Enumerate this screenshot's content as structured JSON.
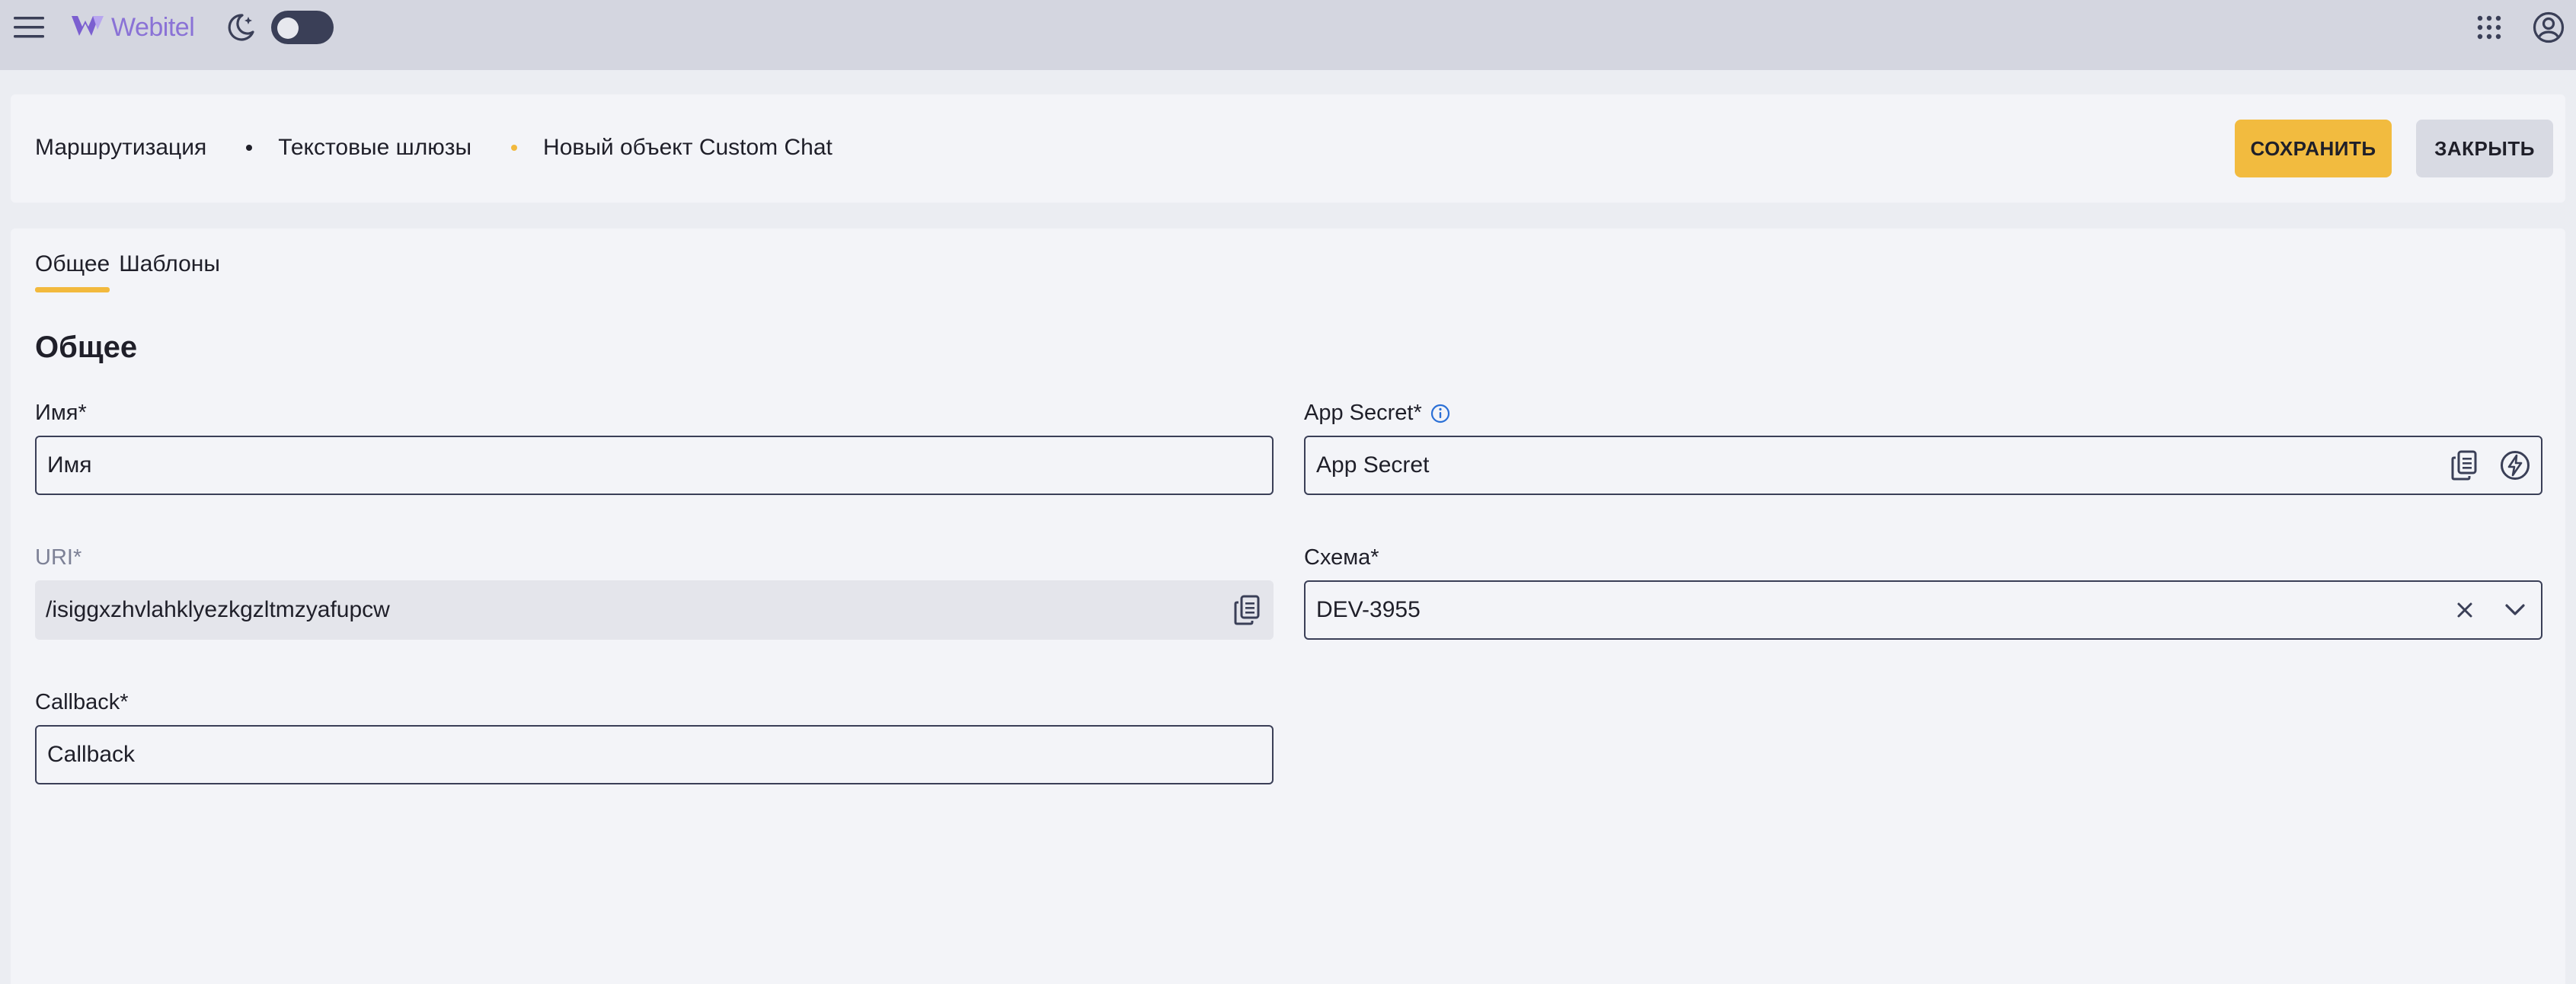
{
  "topbar": {
    "logo_text": "Webitel",
    "icons": [
      "menu-icon",
      "webitel-logo-icon",
      "moon-icon",
      "apps-grid-icon",
      "account-icon"
    ],
    "theme_toggle": "off"
  },
  "header": {
    "breadcrumb": [
      "Маршрутизация",
      "Текстовые шлюзы",
      "Новый объект Custom Chat"
    ],
    "save_label": "СОХРАНИТЬ",
    "close_label": "ЗАКРЫТЬ"
  },
  "tabs": [
    {
      "label": "Общее",
      "active": true
    },
    {
      "label": "Шаблоны",
      "active": false
    }
  ],
  "section_title": "Общее",
  "form": {
    "name": {
      "label": "Имя*",
      "value": "Имя"
    },
    "uri": {
      "label": "URI*",
      "value": "/isiggxzhvlahklyezkgzltmzyafupcw"
    },
    "callback": {
      "label": "Callback*",
      "value": "Callback"
    },
    "app_secret": {
      "label": "App Secret*",
      "value": "App Secret"
    },
    "schema": {
      "label": "Схема*",
      "value": "DEV-3955"
    }
  },
  "colors": {
    "accent": "#f2b93d",
    "topbar_bg": "#d4d6e0",
    "card_bg": "#f3f4f8",
    "logo": "#8a72d6",
    "info": "#2a6fd6"
  }
}
